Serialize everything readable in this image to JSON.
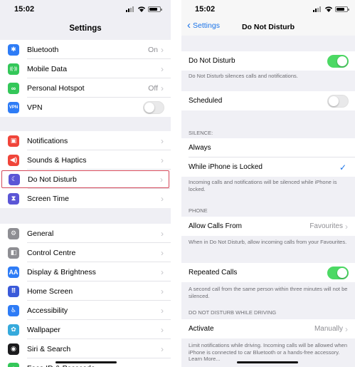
{
  "left": {
    "status_time": "15:02",
    "title": "Settings",
    "group1": [
      {
        "label": "Bluetooth",
        "value": "On",
        "icon": "bluetooth-icon",
        "color": "#2e7cf6",
        "glyph": "✱"
      },
      {
        "label": "Mobile Data",
        "value": "",
        "icon": "antenna-icon",
        "color": "#34c759",
        "glyph": "((·))"
      },
      {
        "label": "Personal Hotspot",
        "value": "Off",
        "icon": "link-icon",
        "color": "#34c759",
        "glyph": "∞"
      },
      {
        "label": "VPN",
        "value": "",
        "icon": "vpn-icon",
        "color": "#2e7cf6",
        "glyph": "VPN"
      }
    ],
    "group2": [
      {
        "label": "Notifications",
        "icon": "notifications-icon",
        "color": "#f0453a",
        "glyph": "▣"
      },
      {
        "label": "Sounds & Haptics",
        "icon": "speaker-icon",
        "color": "#f0453a",
        "glyph": "◀)"
      },
      {
        "label": "Do Not Disturb",
        "icon": "moon-icon",
        "color": "#5b56d6",
        "glyph": "☾"
      },
      {
        "label": "Screen Time",
        "icon": "hourglass-icon",
        "color": "#5b56d6",
        "glyph": "⧗"
      }
    ],
    "group3": [
      {
        "label": "General",
        "icon": "gear-icon",
        "color": "#8e8e93",
        "glyph": "⚙"
      },
      {
        "label": "Control Centre",
        "icon": "switches-icon",
        "color": "#8e8e93",
        "glyph": "◧"
      },
      {
        "label": "Display & Brightness",
        "icon": "text-size-icon",
        "color": "#2e7cf6",
        "glyph": "AA"
      },
      {
        "label": "Home Screen",
        "icon": "app-grid-icon",
        "color": "#3a5ad9",
        "glyph": "⠿"
      },
      {
        "label": "Accessibility",
        "icon": "accessibility-icon",
        "color": "#2e7cf6",
        "glyph": "♿"
      },
      {
        "label": "Wallpaper",
        "icon": "flower-icon",
        "color": "#36aadc",
        "glyph": "✿"
      },
      {
        "label": "Siri & Search",
        "icon": "siri-icon",
        "color": "#1c1c1e",
        "glyph": "◉"
      },
      {
        "label": "Face ID & Passcode",
        "icon": "face-id-icon",
        "color": "#34c759",
        "glyph": "☺"
      }
    ]
  },
  "right": {
    "status_time": "15:02",
    "back_label": "Settings",
    "title": "Do Not Disturb",
    "dnd_label": "Do Not Disturb",
    "dnd_on": true,
    "dnd_footer": "Do Not Disturb silences calls and notifications.",
    "scheduled_label": "Scheduled",
    "scheduled_on": false,
    "silence_header": "SILENCE:",
    "always_label": "Always",
    "locked_label": "While iPhone is Locked",
    "silence_footer": "Incoming calls and notifications will be silenced while iPhone is locked.",
    "phone_header": "PHONE",
    "allow_calls_label": "Allow Calls From",
    "allow_calls_value": "Favourites",
    "allow_calls_footer": "When in Do Not Disturb, allow incoming calls from your Favourites.",
    "repeated_label": "Repeated Calls",
    "repeated_on": true,
    "repeated_footer": "A second call from the same person within three minutes will not be silenced.",
    "driving_header": "DO NOT DISTURB WHILE DRIVING",
    "activate_label": "Activate",
    "activate_value": "Manually",
    "driving_footer": "Limit notifications while driving. Incoming calls will be allowed when iPhone is connected to car Bluetooth or a hands-free accessory. Learn More..."
  },
  "colors": {
    "accent": "#1a73e8",
    "toggle_on": "#4cd964",
    "highlight": "#d4485a"
  }
}
